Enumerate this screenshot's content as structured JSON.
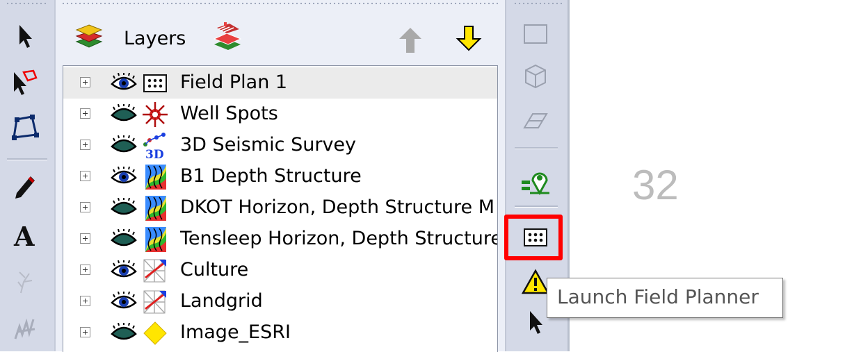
{
  "layers_panel": {
    "title": "Layers",
    "layers": [
      {
        "name": "Field Plan 1",
        "visible": true,
        "selected": true,
        "icon": "field-plan-icon"
      },
      {
        "name": "Well Spots",
        "visible": false,
        "selected": false,
        "icon": "well-spot-icon"
      },
      {
        "name": "3D Seismic Survey",
        "visible": false,
        "selected": false,
        "icon": "seismic-3d-icon"
      },
      {
        "name": "B1 Depth Structure",
        "visible": true,
        "selected": false,
        "icon": "contour-map-icon"
      },
      {
        "name": "DKOT Horizon, Depth Structure M",
        "visible": false,
        "selected": false,
        "icon": "contour-map-icon"
      },
      {
        "name": "Tensleep Horizon, Depth Structure",
        "visible": false,
        "selected": false,
        "icon": "contour-map-icon"
      },
      {
        "name": "Culture",
        "visible": true,
        "selected": false,
        "icon": "culture-icon"
      },
      {
        "name": "Landgrid",
        "visible": true,
        "selected": false,
        "icon": "landgrid-icon"
      },
      {
        "name": "Image_ESRI",
        "visible": false,
        "selected": false,
        "icon": "image-diamond-icon"
      }
    ]
  },
  "canvas": {
    "number": "32"
  },
  "tooltip": {
    "text": "Launch Field Planner"
  },
  "colors": {
    "toolbar_bg": "#d4d9e7",
    "highlight": "#ff0000",
    "selected_row": "#ebebeb"
  }
}
